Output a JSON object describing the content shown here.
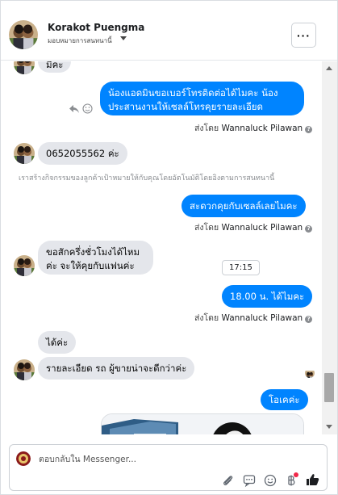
{
  "header": {
    "name": "Korakot Puengma",
    "assign_label": "มอบหมายการสนทนานี้"
  },
  "messages": {
    "partial_top": "มีคะ",
    "out1": "น้องแอดมินขอเบอร์โทรติดต่อได้ไมคะ น้องประสานงานให้เซลล์โทรคุยรายละเอียด",
    "sentby_prefix": "ส่งโดย",
    "agent": "Wannaluck Pilawan",
    "in_phone": "0652055562 ค่ะ",
    "system_note": "เราสร้างกิจกรรมของลูกค้าเป้าหมายให้กับคุณโดยอัตโนมัติโดยอิงตามการสนทนานี้",
    "out2": "สะดวกคุยกับเซลล์เลยไมคะ",
    "in_ask": "ขอสักครึ่งชั่วโมงได้ไหมค่ะ จะให้คุยกับแฟนค่ะ",
    "tooltip_time": "17:15",
    "out3": "18.00 น. ได้ไมคะ",
    "in_ok": "ได้ค่ะ",
    "in_detail": "รายละเอียด รถ ผู้ขายน่าจะดีกว่าค่ะ",
    "out4": "โอเคค่ะ"
  },
  "composer": {
    "placeholder": "ตอบกลับใน Messenger..."
  },
  "icons": {
    "reply": "reply-icon",
    "react": "smile-icon",
    "more": "more-dots-icon",
    "attach": "paperclip-icon",
    "saved_reply": "chat-bubble-icon",
    "emoji": "emoji-icon",
    "payment": "baht-icon",
    "like": "thumbs-up-icon"
  },
  "colors": {
    "outgoing": "#0084ff",
    "incoming": "#e4e6eb",
    "like": "#1c1e21",
    "notification_dot": "#f02849"
  }
}
